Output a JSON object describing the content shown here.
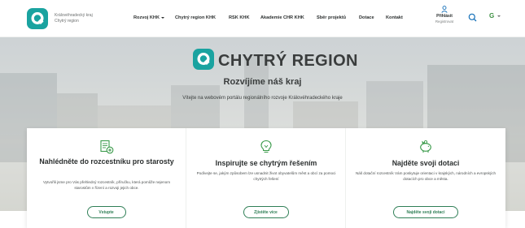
{
  "header": {
    "org_line1": "Královéhradecký kraj",
    "org_line2": "Chytrý region",
    "nav": [
      {
        "label": "Rozvoj KHK",
        "has_dropdown": true
      },
      {
        "label": "Chytrý region KHK",
        "has_dropdown": false
      },
      {
        "label": "RSK KHK",
        "has_dropdown": false
      },
      {
        "label": "Akademie CHR KHK",
        "has_dropdown": false
      },
      {
        "label": "Sběr projektů",
        "has_dropdown": false
      },
      {
        "label": "Dotace",
        "has_dropdown": false
      },
      {
        "label": "Kontakt",
        "has_dropdown": false
      }
    ],
    "login": {
      "main": "Přihlásit",
      "sub": "Registrovat",
      "icon": "user-icon"
    },
    "search_icon": "search-icon",
    "lang_label": "G"
  },
  "hero": {
    "title": "CHYTRÝ REGION",
    "subtitle": "Rozvíjíme náš kraj",
    "description": "Vítejte na webovém portálu regionálního rozvoje Královéhradeckého kraje"
  },
  "cards": [
    {
      "icon": "document-plus-icon",
      "title": "Nahlédněte do rozcestníku pro starosty",
      "text": "Vytvořili jsme pro Vás přehledný rozcestník, příručku, která pomůže nejenom starostům v řízení a rozvoji jejich obce.",
      "button": "Vstupte"
    },
    {
      "icon": "lightbulb-icon",
      "title": "Inspirujte se chytrým řešením",
      "text": "Podívejte se, jakým způsobem lze usnadnit život obyvatelům měst a obcí za pomoci chytrých řešení",
      "button": "Zjistěte více"
    },
    {
      "icon": "piggy-bank-icon",
      "title": "Najděte svoji dotaci",
      "text": "Náš dotační rozcestník Vám poskytuje orientaci v krajských, národních a evropských dotacích pro obce a města.",
      "button": "Najděte svoji dotaci"
    }
  ],
  "colors": {
    "brand_teal": "#1aa3a0",
    "brand_blue": "#1570b8",
    "accent_green": "#2f7f56",
    "text_dark": "#2b2f2f"
  }
}
